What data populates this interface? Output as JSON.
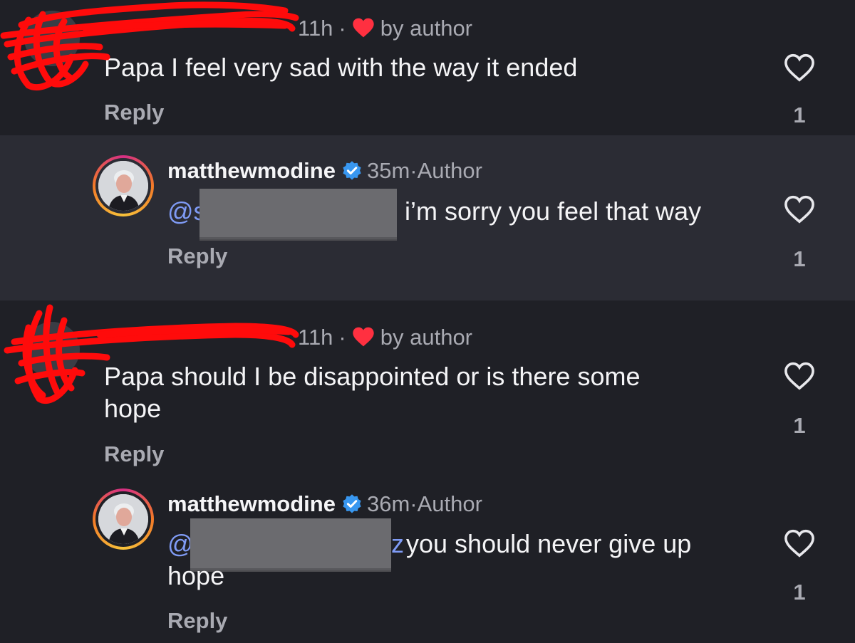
{
  "colors": {
    "background": "#1f2026",
    "highlight": "#2b2c34",
    "mention": "#7f9bf5",
    "heart_red": "#ff3040",
    "verified_blue": "#3897f0",
    "scribble_red": "#ff0b0b"
  },
  "comments": [
    {
      "time": "11h",
      "liked_by_author_label": "by author",
      "text": "Papa I feel very sad with the way it ended",
      "reply_label": "Reply",
      "like_count": "1",
      "reply": {
        "username": "matthewmodine",
        "verified": true,
        "time": "35m",
        "author_label": "Author",
        "mention_prefix": "@s",
        "text": "i’m sorry you feel that way",
        "reply_label": "Reply",
        "like_count": "1"
      }
    },
    {
      "time": "11h",
      "liked_by_author_label": "by author",
      "text_line1": "Papa should I be disappointed or is there some",
      "text_line2": "hope",
      "reply_label": "Reply",
      "like_count": "1",
      "reply": {
        "username": "matthewmodine",
        "verified": true,
        "time": "36m",
        "author_label": "Author",
        "mention_prefix": "@",
        "mention_suffix": "z",
        "text_line1": "you should never give up",
        "text_line2": "hope",
        "reply_label": "Reply",
        "like_count": "1"
      }
    }
  ]
}
